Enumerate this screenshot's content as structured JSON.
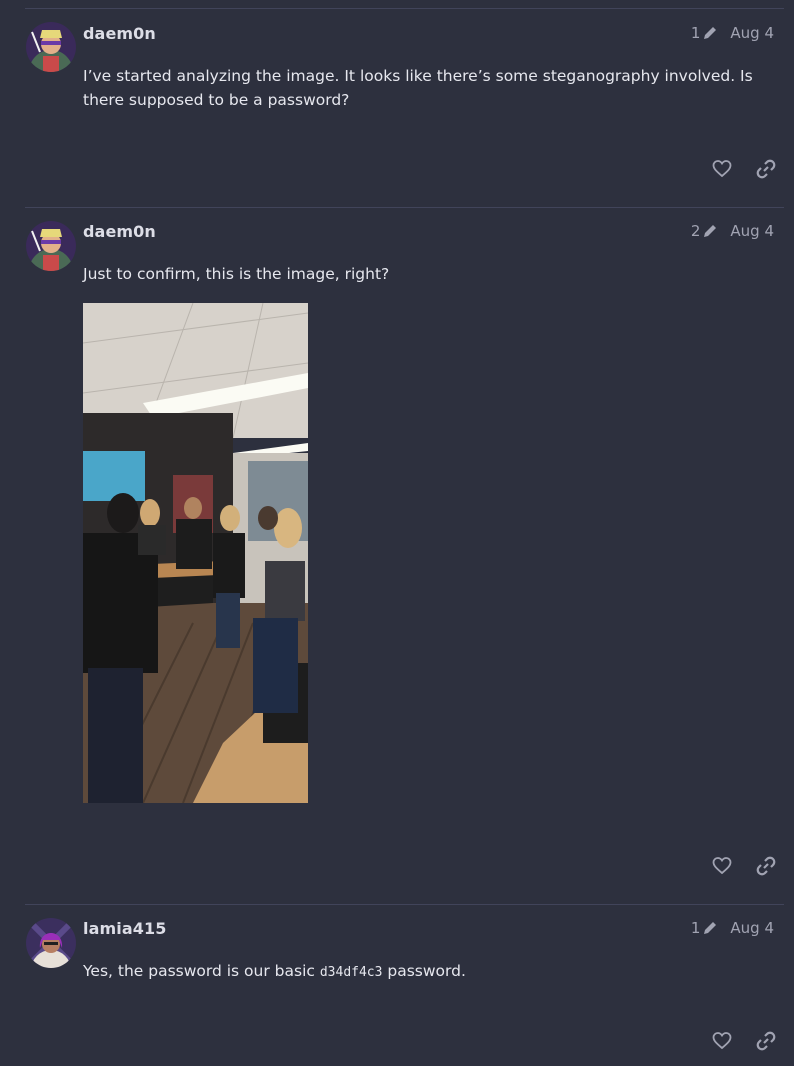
{
  "posts": [
    {
      "username": "daem0n",
      "edits": "1",
      "date": "Aug 4",
      "text": "I’ve started analyzing the image. It looks like there’s some steganography involved. Is there supposed to be a password?"
    },
    {
      "username": "daem0n",
      "edits": "2",
      "date": "Aug 4",
      "text": "Just to confirm, this is the image, right?"
    },
    {
      "username": "lamia415",
      "edits": "1",
      "date": "Aug 4",
      "text_before": "Yes, the password is our basic ",
      "code": "d34df4c3",
      "text_after": " password."
    }
  ],
  "icons": {
    "edit": "pencil-icon",
    "like": "heart-icon",
    "share": "link-icon"
  },
  "colors": {
    "background": "#2d303e",
    "divider": "#41445a",
    "muted": "#a1a3b2",
    "text": "#e6e7ee"
  }
}
